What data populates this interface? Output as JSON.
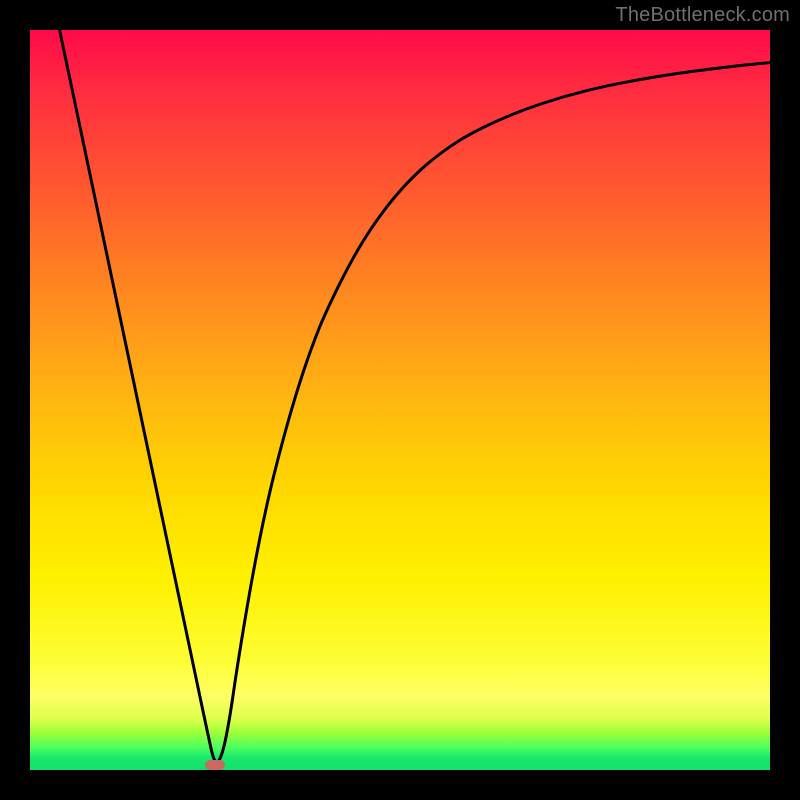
{
  "watermark": "TheBottleneck.com",
  "chart_data": {
    "type": "line",
    "title": "",
    "xlabel": "",
    "ylabel": "",
    "xlim": [
      0,
      100
    ],
    "ylim": [
      0,
      100
    ],
    "grid": false,
    "series": [
      {
        "name": "curve",
        "x": [
          4,
          6,
          8,
          10,
          12,
          14,
          16,
          18,
          20,
          22,
          24,
          25,
          26,
          27,
          28,
          30,
          32,
          34,
          36,
          38,
          40,
          44,
          48,
          52,
          56,
          60,
          66,
          72,
          78,
          84,
          90,
          96,
          100
        ],
        "values": [
          100,
          90.5,
          81,
          71.5,
          62,
          52.5,
          43,
          33.5,
          24,
          14.5,
          5,
          0.5,
          2,
          7,
          14,
          26,
          36,
          44,
          51,
          57,
          62,
          70,
          76,
          80.5,
          83.8,
          86.3,
          89,
          91,
          92.5,
          93.6,
          94.5,
          95.2,
          95.6
        ]
      }
    ],
    "marker": {
      "x": 25,
      "y": 0.7
    },
    "gradient_stops": [
      {
        "pos": 0.0,
        "color": "#ff0a4a"
      },
      {
        "pos": 0.5,
        "color": "#ffd500"
      },
      {
        "pos": 0.93,
        "color": "#fdfd33"
      },
      {
        "pos": 1.0,
        "color": "#14e06a"
      }
    ]
  }
}
